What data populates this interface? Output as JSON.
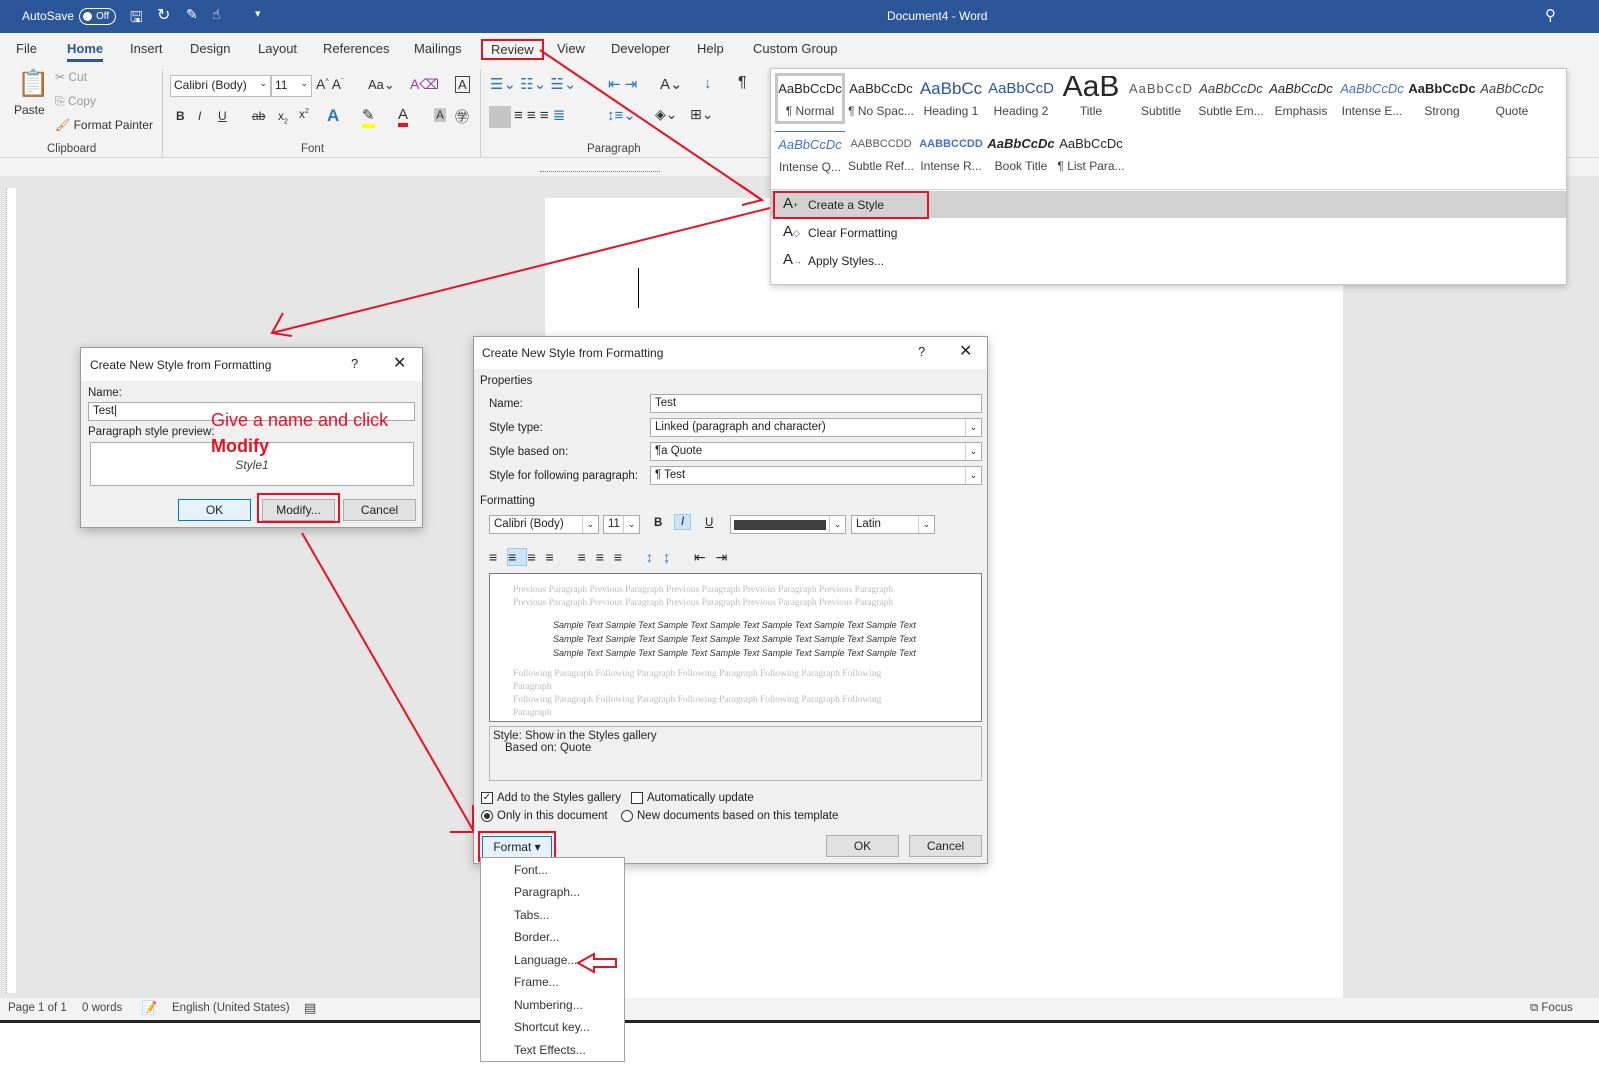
{
  "titlebar": {
    "autosave": "AutoSave",
    "autosave_state": "Off",
    "title": "Document4  -  Word"
  },
  "tabs": [
    "File",
    "Home",
    "Insert",
    "Design",
    "Layout",
    "References",
    "Mailings",
    "Review",
    "View",
    "Developer",
    "Help",
    "Custom Group"
  ],
  "ribbon": {
    "clipboard": {
      "paste": "Paste",
      "cut": "Cut",
      "copy": "Copy",
      "format_painter": "Format Painter",
      "label": "Clipboard"
    },
    "font": {
      "font_name": "Calibri (Body)",
      "font_size": "11",
      "label": "Font",
      "bold": "B",
      "italic": "I",
      "underline": "U",
      "change_case": "Aa"
    },
    "paragraph": {
      "label": "Paragraph",
      "pilcrow": "¶"
    }
  },
  "styles_gallery": {
    "row1": [
      {
        "sample": "AaBbCcDc",
        "name": "¶ Normal"
      },
      {
        "sample": "AaBbCcDc",
        "name": "¶ No Spac..."
      },
      {
        "sample": "AaBbCc",
        "name": "Heading 1"
      },
      {
        "sample": "AaBbCcD",
        "name": "Heading 2"
      },
      {
        "sample": "AaB",
        "name": "Title"
      },
      {
        "sample": "AaBbCcD",
        "name": "Subtitle"
      },
      {
        "sample": "AaBbCcDc",
        "name": "Subtle Em..."
      },
      {
        "sample": "AaBbCcDc",
        "name": "Emphasis"
      },
      {
        "sample": "AaBbCcDc",
        "name": "Intense E..."
      },
      {
        "sample": "AaBbCcDc",
        "name": "Strong"
      },
      {
        "sample": "AaBbCcDc",
        "name": "Quote"
      }
    ],
    "row2": [
      {
        "sample": "AaBbCcDc",
        "name": "Intense Q..."
      },
      {
        "sample": "AABBCCDD",
        "name": "Subtle Ref..."
      },
      {
        "sample": "AABBCCDD",
        "name": "Intense R..."
      },
      {
        "sample": "AaBbCcDc",
        "name": "Book Title"
      },
      {
        "sample": "AaBbCcDc",
        "name": "¶ List Para..."
      }
    ],
    "menu": [
      "Create a Style",
      "Clear Formatting",
      "Apply Styles..."
    ]
  },
  "small_dialog": {
    "title": "Create New Style from Formatting",
    "help": "?",
    "name_label": "Name:",
    "name_value": "Test",
    "preview_label": "Paragraph style preview:",
    "preview_text": "Style1",
    "ok": "OK",
    "modify": "Modify...",
    "cancel": "Cancel"
  },
  "annotation": {
    "line1": "Give a name and click",
    "line2": "Modify"
  },
  "big_dialog": {
    "title": "Create New Style from Formatting",
    "help": "?",
    "properties": "Properties",
    "name_label": "Name:",
    "name_value": "Test",
    "style_type_label": "Style type:",
    "style_type_value": "Linked (paragraph and character)",
    "based_on_label": "Style based on:",
    "based_on_value": "¶a  Quote",
    "following_label": "Style for following paragraph:",
    "following_value": "¶  Test",
    "formatting": "Formatting",
    "font": "Calibri (Body)",
    "size": "11",
    "bold": "B",
    "italic": "I",
    "underline": "U",
    "script": "Latin",
    "preview_previous": "Previous Paragraph Previous Paragraph Previous Paragraph Previous Paragraph Previous Paragraph Previous Paragraph Previous Paragraph Previous Paragraph Previous Paragraph Previous Paragraph",
    "preview_sample": [
      "Sample Text Sample Text Sample Text Sample Text Sample Text Sample Text Sample Text",
      "Sample Text Sample Text Sample Text Sample Text Sample Text Sample Text Sample Text",
      "Sample Text Sample Text Sample Text Sample Text Sample Text Sample Text Sample Text"
    ],
    "preview_following": "Following Paragraph Following Paragraph Following Paragraph Following Paragraph Following Paragraph",
    "description": "Style: Show in the Styles gallery",
    "description2": "Based on: Quote",
    "add_to_gallery": "Add to the Styles gallery",
    "add_to_gallery_checked": true,
    "auto_update": "Automatically update",
    "auto_update_checked": false,
    "only_this_doc": "Only in this document",
    "new_docs": "New documents based on this template",
    "format": "Format ▾",
    "ok": "OK",
    "cancel": "Cancel"
  },
  "format_menu": [
    "Font...",
    "Paragraph...",
    "Tabs...",
    "Border...",
    "Language...",
    "Frame...",
    "Numbering...",
    "Shortcut key...",
    "Text Effects..."
  ],
  "status": {
    "page": "Page 1 of 1",
    "words": "0 words",
    "language": "English (United States)",
    "focus": "Focus"
  },
  "colors": {
    "word_blue": "#2b579a",
    "annotation_red": "#e81123"
  }
}
